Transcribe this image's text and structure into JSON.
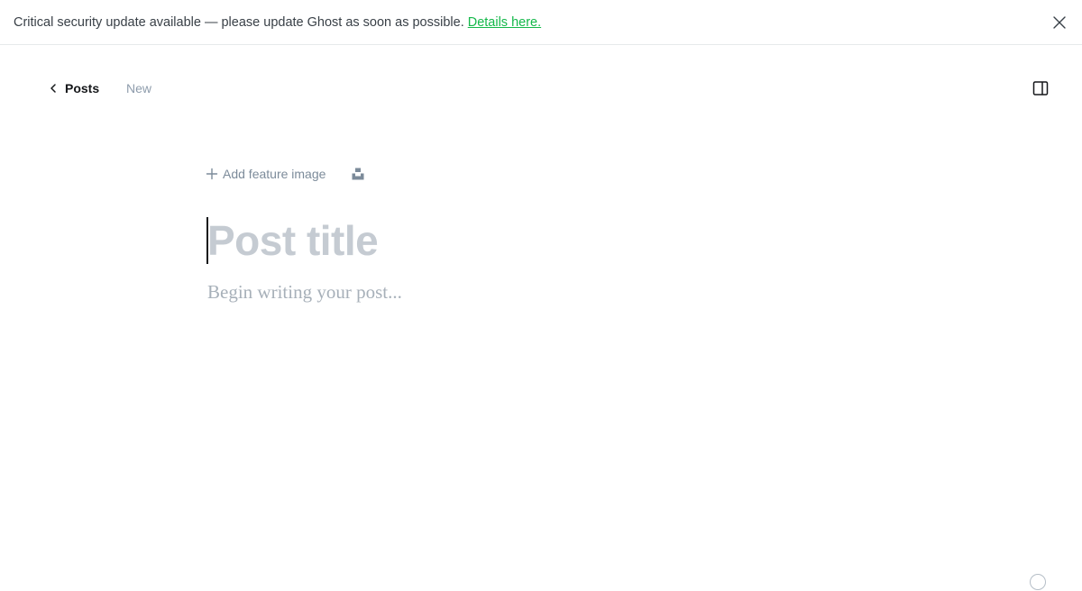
{
  "banner": {
    "message": "Critical security update available — please update Ghost as soon as possible.",
    "link_label": "Details here.",
    "close_icon": "close-icon",
    "link_color": "#14b84a"
  },
  "topbar": {
    "back_label": "Posts",
    "status_label": "New",
    "back_icon": "chevron-left-icon",
    "sidebar_icon": "sidebar-toggle-icon"
  },
  "editor": {
    "feature_image_label": "Add feature image",
    "unsplash_icon": "unsplash-icon",
    "title_placeholder": "Post title",
    "body_placeholder": "Begin writing your post..."
  },
  "footer": {
    "word_count_label": "",
    "help_icon": "help-icon"
  }
}
